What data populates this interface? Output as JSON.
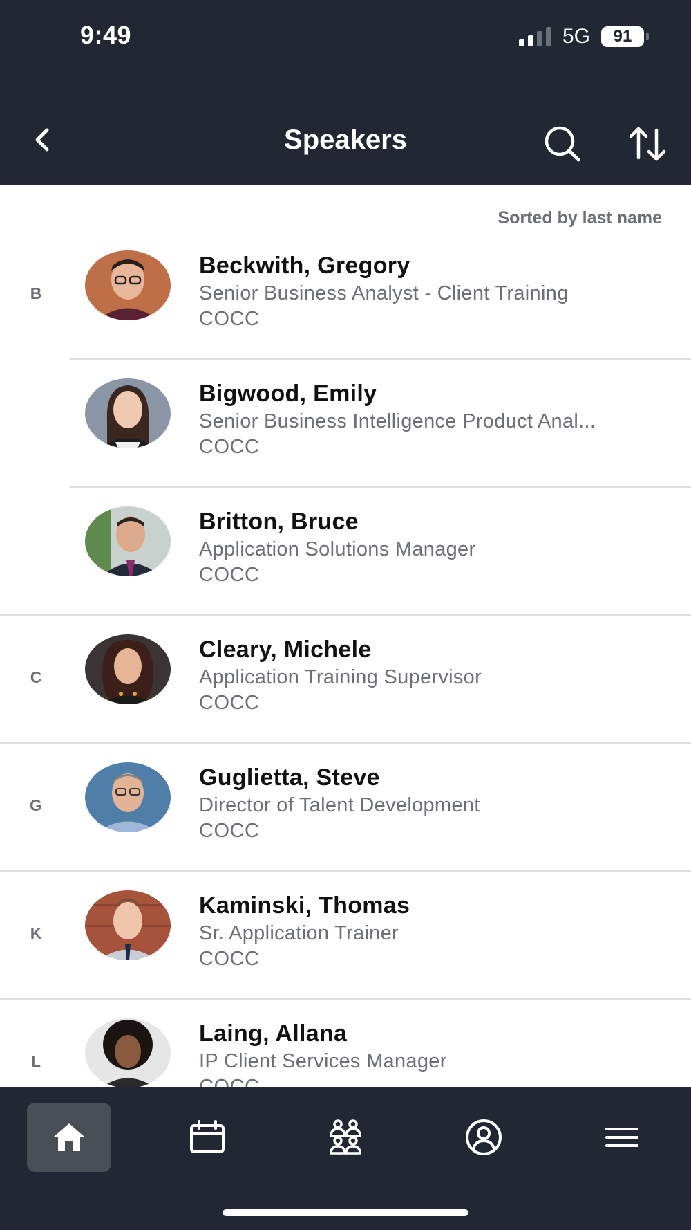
{
  "status_bar": {
    "time": "9:49",
    "network": "5G",
    "battery": "91"
  },
  "header": {
    "title": "Speakers"
  },
  "sort_note": "Sorted by last name",
  "speakers": [
    {
      "letter": "B",
      "name": "Beckwith, Gregory",
      "title": "Senior Business Analyst - Client Training",
      "company": "COCC"
    },
    {
      "letter": "",
      "name": "Bigwood, Emily",
      "title": "Senior Business Intelligence Product Anal...",
      "company": "COCC"
    },
    {
      "letter": "",
      "name": "Britton, Bruce",
      "title": "Application Solutions Manager",
      "company": "COCC"
    },
    {
      "letter": "C",
      "name": "Cleary, Michele",
      "title": "Application Training Supervisor",
      "company": "COCC"
    },
    {
      "letter": "G",
      "name": "Guglietta, Steve",
      "title": "Director of Talent Development",
      "company": "COCC"
    },
    {
      "letter": "K",
      "name": "Kaminski, Thomas",
      "title": "Sr. Application Trainer",
      "company": "COCC"
    },
    {
      "letter": "L",
      "name": "Laing, Allana",
      "title": "IP Client Services Manager",
      "company": "COCC"
    }
  ],
  "tabs": [
    {
      "icon": "home-icon",
      "active": true
    },
    {
      "icon": "calendar-icon",
      "active": false
    },
    {
      "icon": "people-icon",
      "active": false
    },
    {
      "icon": "profile-icon",
      "active": false
    },
    {
      "icon": "menu-icon",
      "active": false
    }
  ],
  "colors": {
    "header_bg": "#222733",
    "active_tab_bg": "#4a4e57",
    "secondary_text": "#6c6f75"
  }
}
